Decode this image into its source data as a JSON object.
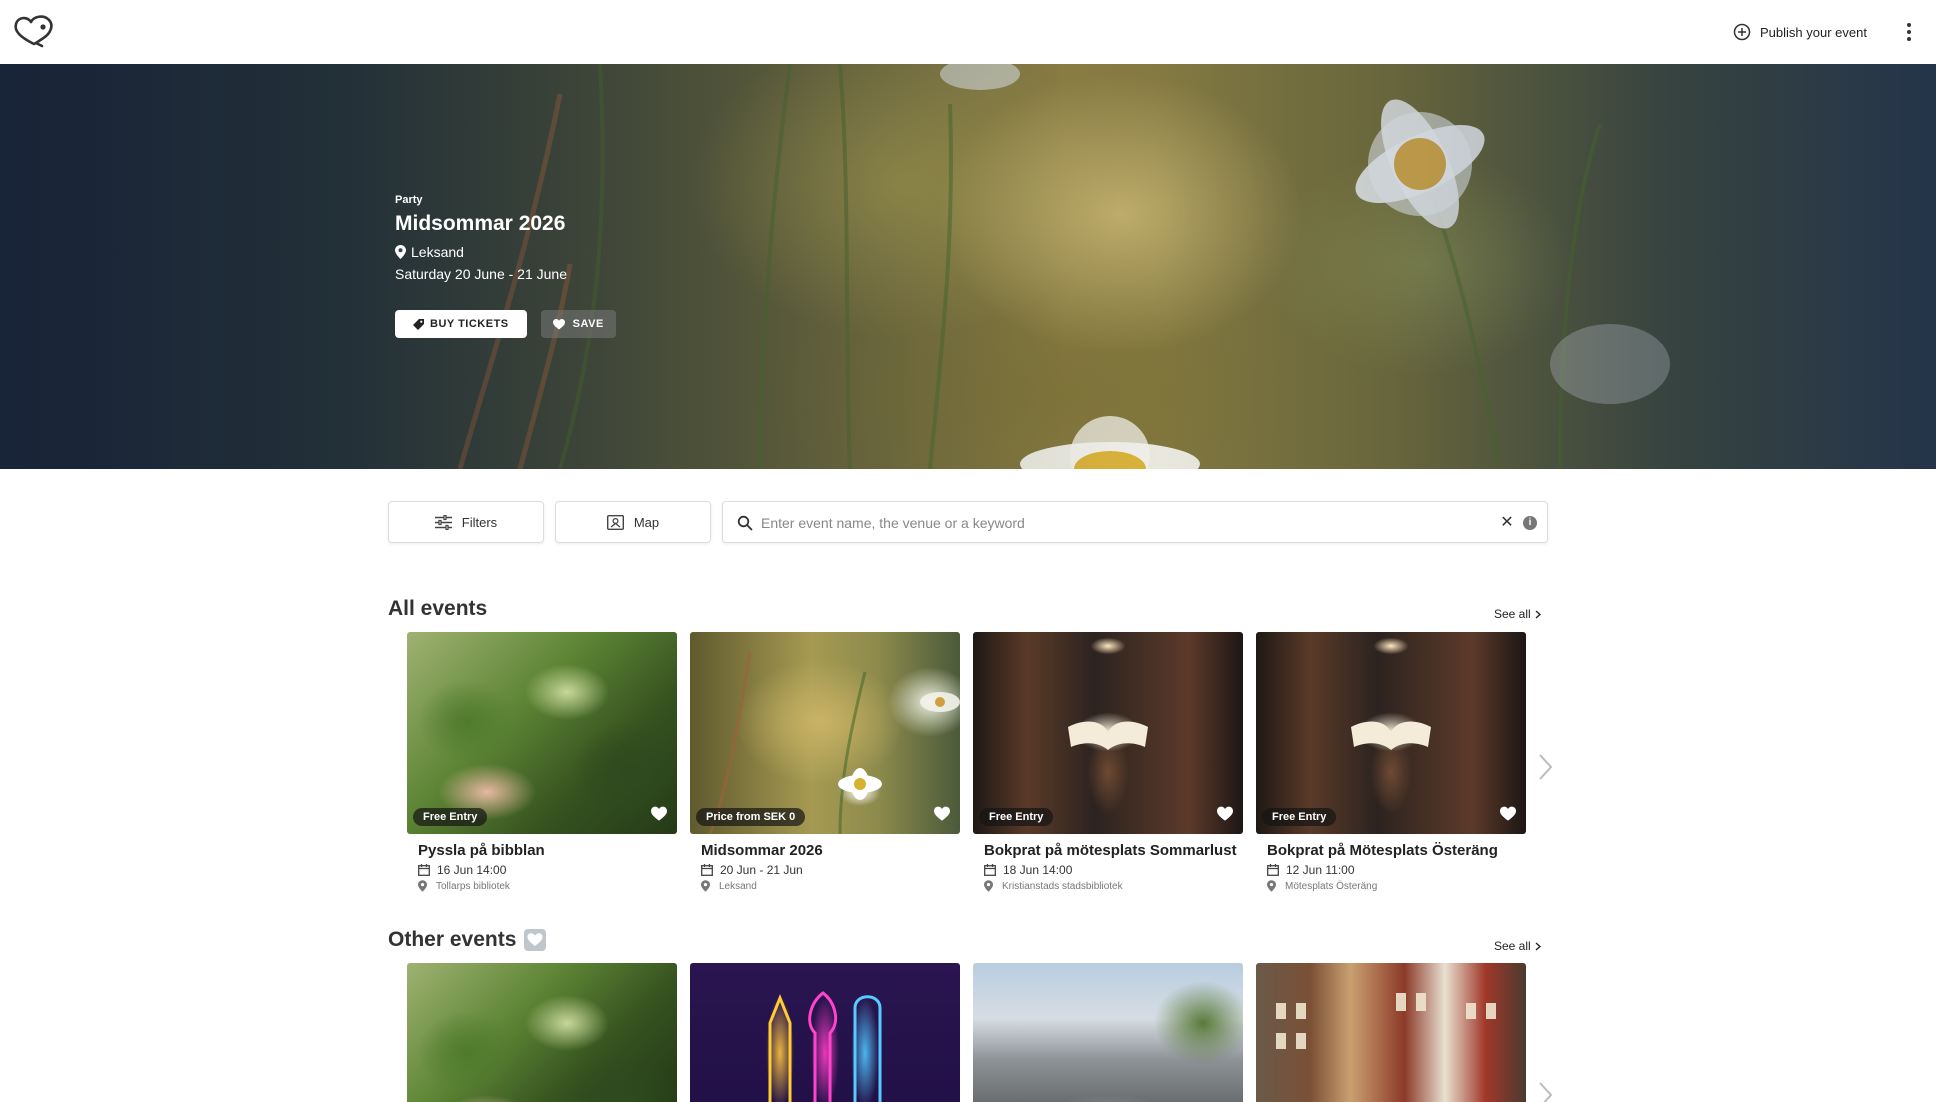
{
  "header": {
    "publish_label": "Publish your event"
  },
  "hero": {
    "category": "Party",
    "title": "Midsommar 2026",
    "location": "Leksand",
    "date": "Saturday 20 June - 21 June",
    "buy_label": "BUY TICKETS",
    "save_label": "SAVE"
  },
  "search": {
    "filters_label": "Filters",
    "map_label": "Map",
    "placeholder": "Enter event name, the venue or a keyword",
    "clear_symbol": "✕",
    "info_symbol": "i"
  },
  "sections": {
    "all_events": {
      "title": "All events",
      "see_all": "See all",
      "cards": [
        {
          "badge": "Free Entry",
          "title": "Pyssla på bibblan",
          "date": "16 Jun 14:00",
          "venue": "Tollarps bibliotek",
          "image": "plant-yarn"
        },
        {
          "badge": "Price from SEK 0",
          "title": "Midsommar 2026",
          "date": "20 Jun - 21 Jun",
          "venue": "Leksand",
          "image": "daisy-field"
        },
        {
          "badge": "Free Entry",
          "title": "Bokprat på mötesplats Sommarlust",
          "date": "18 Jun 14:00",
          "venue": "Kristianstads stadsbibliotek",
          "image": "library-book"
        },
        {
          "badge": "Free Entry",
          "title": "Bokprat på Mötesplats Österäng",
          "date": "12 Jun 11:00",
          "venue": "Mötesplats Österäng",
          "image": "library-book"
        }
      ]
    },
    "other_events": {
      "title": "Other events",
      "see_all": "See all"
    }
  },
  "colors": {
    "hero_overlay": "#1e2b3e",
    "badge_bg": "#141414",
    "text": "#222222"
  }
}
